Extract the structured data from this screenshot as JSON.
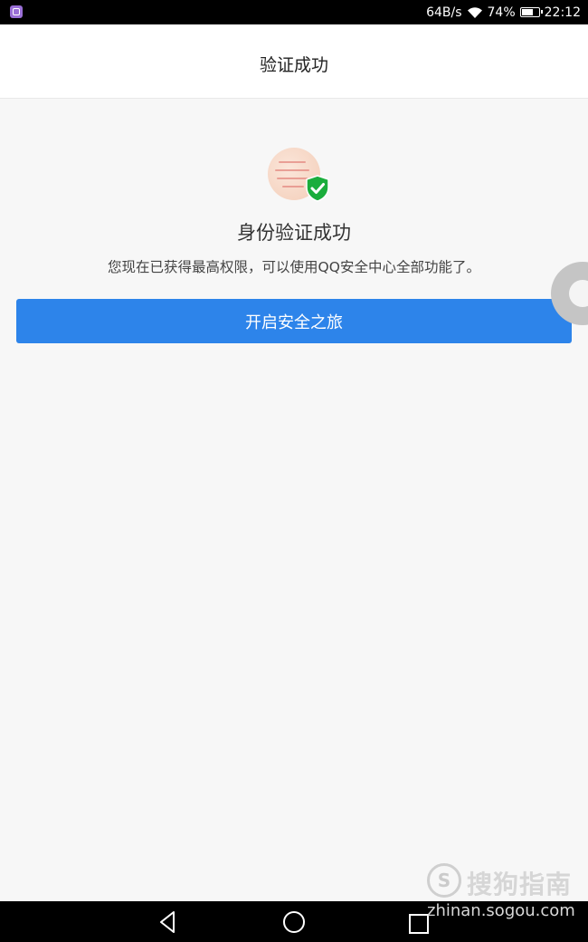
{
  "status_bar": {
    "network_speed": "64B/s",
    "battery_percent": "74%",
    "battery_level": 0.74,
    "time": "22:12",
    "icons": [
      "app-notification-icon",
      "wifi-icon",
      "battery-icon"
    ]
  },
  "header": {
    "title": "验证成功"
  },
  "main": {
    "title": "身份验证成功",
    "description": "您现在已获得最高权限，可以使用QQ安全中心全部功能了。",
    "button_label": "开启安全之旅",
    "badge_icon": "shield-check-icon"
  },
  "colors": {
    "accent": "#2d84ea",
    "badge_green": "#1aad3c",
    "background": "#f7f7f7"
  },
  "watermark": {
    "logo_letter": "S",
    "brand": "搜狗指南",
    "url": "zhinan.sogou.com"
  },
  "nav_bar": {
    "icons": [
      "back-icon",
      "home-icon",
      "recent-apps-icon"
    ]
  }
}
